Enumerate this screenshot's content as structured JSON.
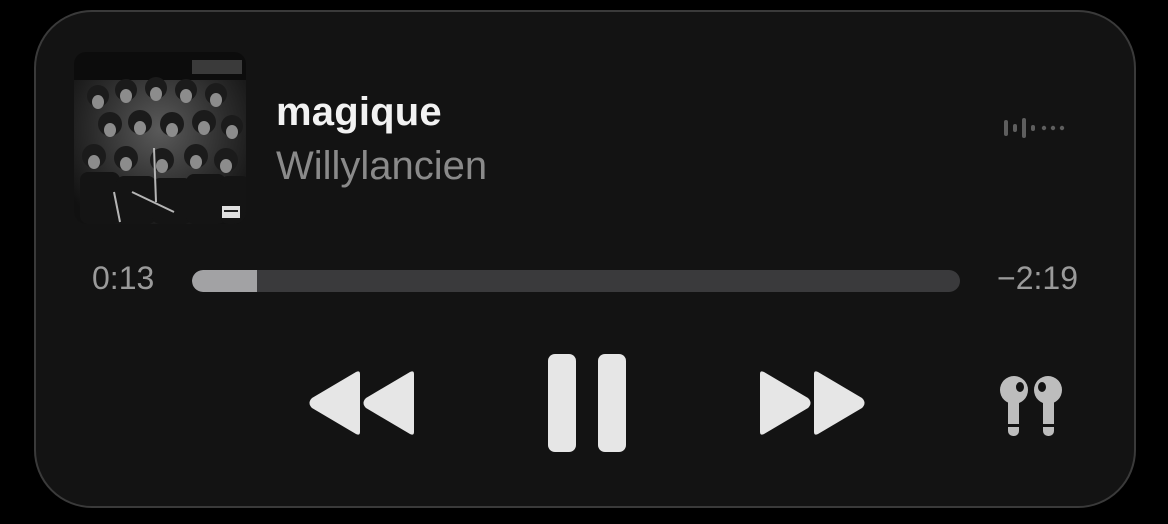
{
  "track": {
    "title": "magique",
    "artist": "Willylancien"
  },
  "playback": {
    "elapsed": "0:13",
    "remaining": "−2:19",
    "progress_percent": 8.5
  },
  "icons": {
    "rewind": "backward-icon",
    "pause": "pause-icon",
    "forward": "forward-icon",
    "output": "airpods-icon",
    "waveform": "audio-waveform-icon"
  },
  "colors": {
    "background": "#131313",
    "title": "#f2f2f2",
    "secondary": "#8a8a8a",
    "track_bg": "#3a3a3c",
    "track_fill": "#a2a2a4",
    "controls": "#e6e6e6"
  }
}
